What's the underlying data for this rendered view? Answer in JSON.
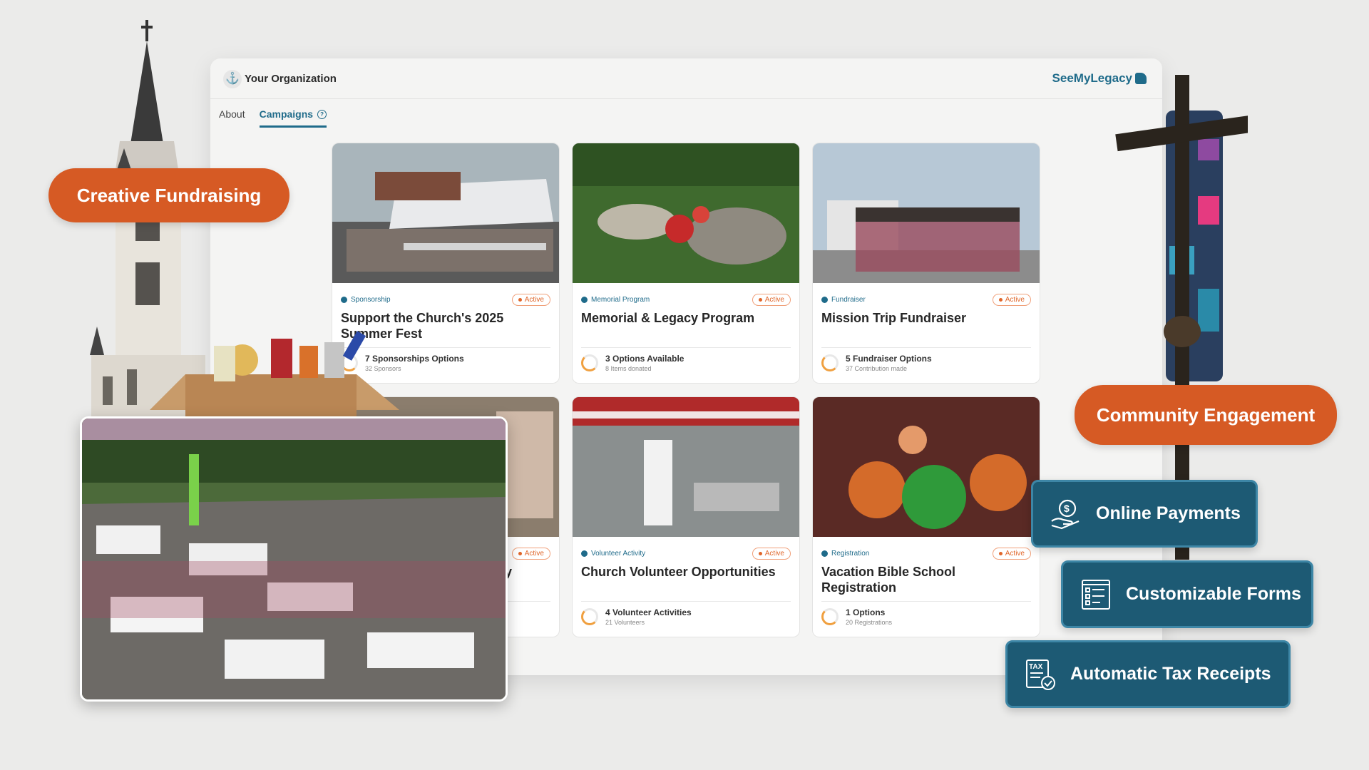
{
  "app": {
    "org_name": "Your Organization",
    "brand": "SeeMyLegacy",
    "tabs": [
      {
        "label": "About"
      },
      {
        "label": "Campaigns"
      }
    ]
  },
  "cards": [
    {
      "category": "Sponsorship",
      "status": "Active",
      "title": "Support the Church's 2025 Summer Fest",
      "stat": "7 Sponsorships Options",
      "sub": "32 Sponsors"
    },
    {
      "category": "Memorial Program",
      "status": "Active",
      "title": "Memorial & Legacy Program",
      "stat": "3 Options Available",
      "sub": "8 Items donated"
    },
    {
      "category": "Fundraiser",
      "status": "Active",
      "title": "Mission Trip Fundraiser",
      "stat": "5 Fundraiser Options",
      "sub": "37 Contribution made"
    },
    {
      "category": "",
      "status": "Active",
      "title": "ly",
      "stat": "",
      "sub": ""
    },
    {
      "category": "Volunteer Activity",
      "status": "Active",
      "title": "Church Volunteer Opportunities",
      "stat": "4 Volunteer Activities",
      "sub": "21 Volunteers"
    },
    {
      "category": "Registration",
      "status": "Active",
      "title": "Vacation Bible School Registration",
      "stat": "1 Options",
      "sub": "20 Registrations"
    }
  ],
  "bubbles": {
    "creative": "Creative Fundraising",
    "community": "Community Engagement"
  },
  "features": [
    {
      "label": "Online Payments",
      "icon": "hand-dollar-icon"
    },
    {
      "label": "Customizable Forms",
      "icon": "form-icon"
    },
    {
      "label": "Automatic Tax Receipts",
      "icon": "tax-receipt-icon"
    }
  ],
  "colors": {
    "accent": "#1f6b8a",
    "bubble": "#d65a24",
    "feature": "#1d5a74",
    "active": "#e0662a"
  }
}
